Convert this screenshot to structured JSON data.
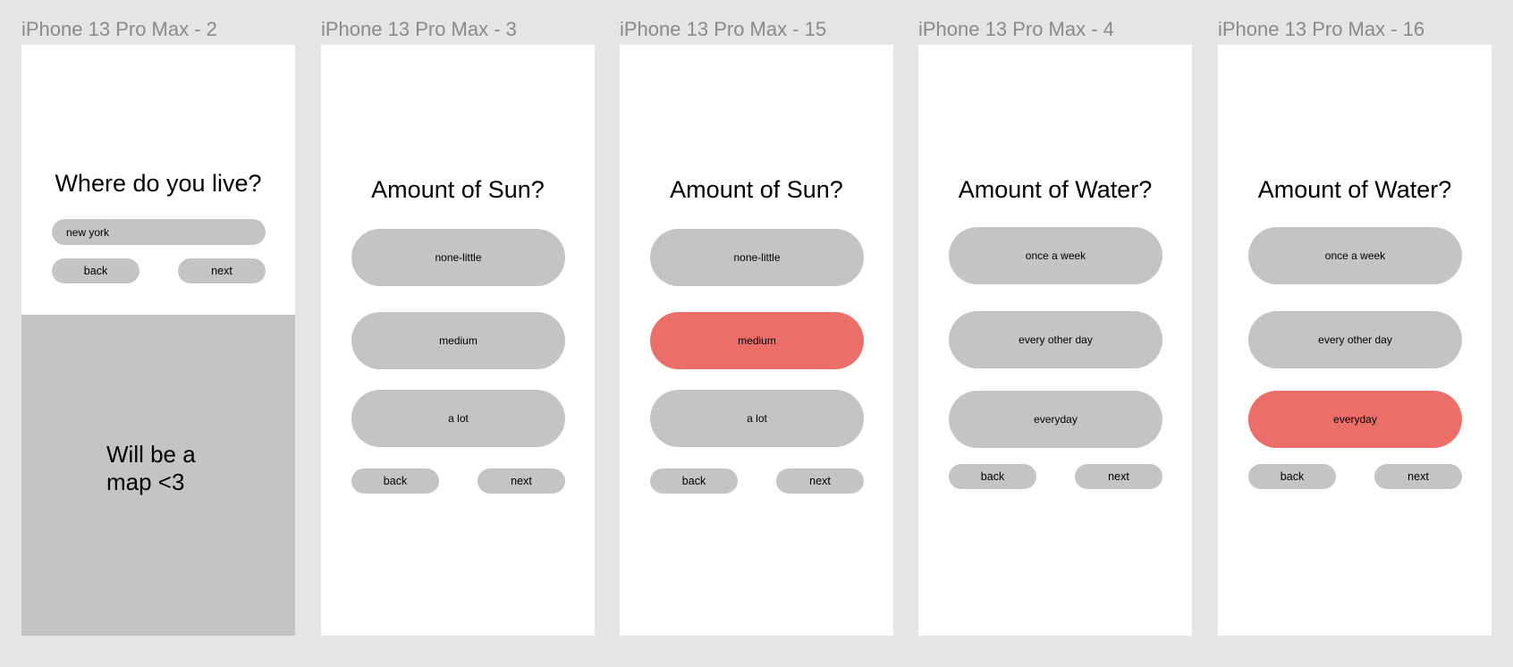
{
  "frames": [
    {
      "label": "iPhone 13 Pro Max - 2",
      "title": "Where do you live?",
      "input_value": "new york",
      "back_label": "back",
      "next_label": "next",
      "map_text": "Will be a\nmap <3"
    },
    {
      "label": "iPhone 13 Pro Max - 3",
      "title": "Amount of Sun?",
      "options": [
        "none-little",
        "medium",
        "a lot"
      ],
      "selected": null,
      "back_label": "back",
      "next_label": "next"
    },
    {
      "label": "iPhone 13 Pro Max - 15",
      "title": "Amount of Sun?",
      "options": [
        "none-little",
        "medium",
        "a lot"
      ],
      "selected": "medium",
      "back_label": "back",
      "next_label": "next"
    },
    {
      "label": "iPhone 13 Pro Max - 4",
      "title": "Amount of Water?",
      "options": [
        "once a week",
        "every other day",
        "everyday"
      ],
      "selected": null,
      "back_label": "back",
      "next_label": "next"
    },
    {
      "label": "iPhone 13 Pro Max - 16",
      "title": "Amount of Water?",
      "options": [
        "once a week",
        "every other day",
        "everyday"
      ],
      "selected": "everyday",
      "back_label": "back",
      "next_label": "next"
    }
  ],
  "colors": {
    "canvas": "#e5e5e5",
    "frame": "#ffffff",
    "pill": "#c4c4c4",
    "selected": "#ec6e69",
    "label": "#8a8a8a"
  }
}
